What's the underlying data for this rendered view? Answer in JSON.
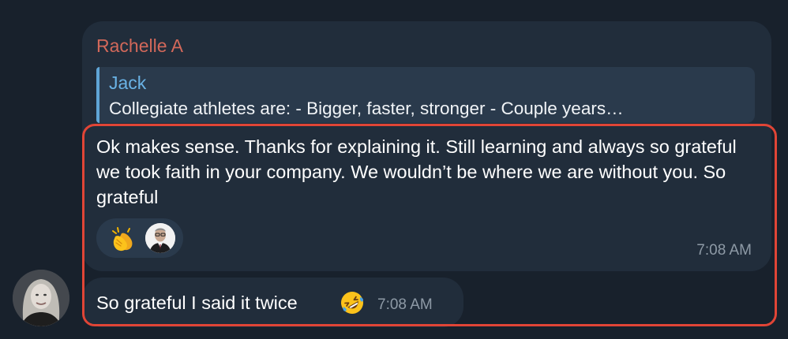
{
  "conversation": {
    "sender_name": "Rachelle A",
    "avatar_icon": "user-avatar-photo",
    "reply": {
      "author": "Jack",
      "text": "Collegiate athletes are:  - Bigger, faster, stronger - Couple years…"
    },
    "message": {
      "text": "Ok makes sense. Thanks for explaining it. Still learning and always so grateful we took faith in your company. We wouldn’t be where we are without you. So grateful",
      "time": "7:08 AM",
      "reactions": [
        {
          "emoji": "clapping-hands-icon",
          "reactor": "reactor-avatar-photo"
        }
      ]
    },
    "followup": {
      "text": "So grateful I said it twice",
      "emoji": "rolling-on-floor-laughing-icon",
      "time": "7:08 AM"
    },
    "colors": {
      "background": "#18212c",
      "bubble": "#212d3b",
      "sender_name": "#d2685a",
      "reply_author": "#6ab3e6",
      "timestamp": "#8e9aa6",
      "highlight_border": "#e14536"
    }
  }
}
